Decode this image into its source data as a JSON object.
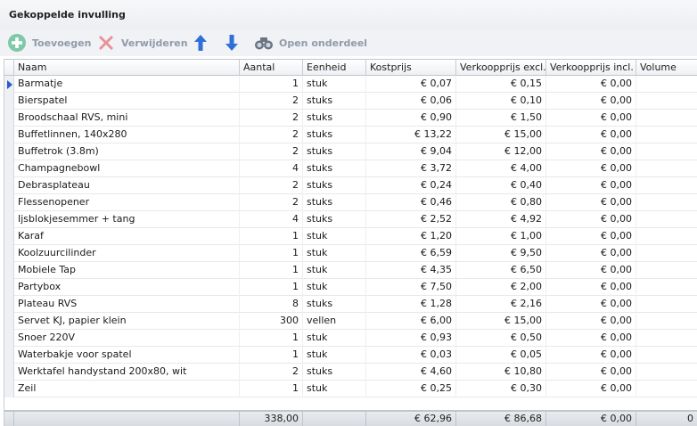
{
  "panel": {
    "title": "Gekoppelde invulling"
  },
  "toolbar": {
    "add_label": "Toevoegen",
    "delete_label": "Verwijderen",
    "open_label": "Open onderdeel"
  },
  "colors": {
    "add": "#7fc8a9",
    "delete": "#e8909a",
    "arrows": "#2f6fd6",
    "binoculars": "#6b7480"
  },
  "table": {
    "columns": {
      "name": "Naam",
      "qty": "Aantal",
      "unit": "Eenheid",
      "cost": "Kostprijs",
      "excl": "Verkoopprijs excl.",
      "incl": "Verkoopprijs incl.",
      "volume": "Volume"
    },
    "rows": [
      {
        "name": "Barmatje",
        "qty": "1",
        "unit": "stuk",
        "cost": "€ 0,07",
        "excl": "€ 0,15",
        "incl": "€ 0,00"
      },
      {
        "name": "Bierspatel",
        "qty": "2",
        "unit": "stuks",
        "cost": "€ 0,06",
        "excl": "€ 0,10",
        "incl": "€ 0,00"
      },
      {
        "name": "Broodschaal RVS, mini",
        "qty": "2",
        "unit": "stuks",
        "cost": "€ 0,90",
        "excl": "€ 1,50",
        "incl": "€ 0,00"
      },
      {
        "name": "Buffetlinnen, 140x280",
        "qty": "2",
        "unit": "stuks",
        "cost": "€ 13,22",
        "excl": "€ 15,00",
        "incl": "€ 0,00"
      },
      {
        "name": "Buffetrok (3.8m)",
        "qty": "2",
        "unit": "stuks",
        "cost": "€ 9,04",
        "excl": "€ 12,00",
        "incl": "€ 0,00"
      },
      {
        "name": "Champagnebowl",
        "qty": "4",
        "unit": "stuks",
        "cost": "€ 3,72",
        "excl": "€ 4,00",
        "incl": "€ 0,00"
      },
      {
        "name": "Debrasplateau",
        "qty": "2",
        "unit": "stuks",
        "cost": "€ 0,24",
        "excl": "€ 0,40",
        "incl": "€ 0,00"
      },
      {
        "name": "Flessenopener",
        "qty": "2",
        "unit": "stuks",
        "cost": "€ 0,46",
        "excl": "€ 0,80",
        "incl": "€ 0,00"
      },
      {
        "name": "Ijsblokjesemmer + tang",
        "qty": "4",
        "unit": "stuks",
        "cost": "€ 2,52",
        "excl": "€ 4,92",
        "incl": "€ 0,00"
      },
      {
        "name": "Karaf",
        "qty": "1",
        "unit": "stuk",
        "cost": "€ 1,20",
        "excl": "€ 1,00",
        "incl": "€ 0,00"
      },
      {
        "name": "Koolzuurcilinder",
        "qty": "1",
        "unit": "stuk",
        "cost": "€ 6,59",
        "excl": "€ 9,50",
        "incl": "€ 0,00"
      },
      {
        "name": "Mobiele Tap",
        "qty": "1",
        "unit": "stuk",
        "cost": "€ 4,35",
        "excl": "€ 6,50",
        "incl": "€ 0,00"
      },
      {
        "name": "Partybox",
        "qty": "1",
        "unit": "stuk",
        "cost": "€ 7,50",
        "excl": "€ 2,00",
        "incl": "€ 0,00"
      },
      {
        "name": "Plateau RVS",
        "qty": "8",
        "unit": "stuks",
        "cost": "€ 1,28",
        "excl": "€ 2,16",
        "incl": "€ 0,00"
      },
      {
        "name": "Servet KJ, papier klein",
        "qty": "300",
        "unit": "vellen",
        "cost": "€ 6,00",
        "excl": "€ 15,00",
        "incl": "€ 0,00"
      },
      {
        "name": "Snoer 220V",
        "qty": "1",
        "unit": "stuk",
        "cost": "€ 0,93",
        "excl": "€ 0,50",
        "incl": "€ 0,00"
      },
      {
        "name": "Waterbakje voor spatel",
        "qty": "1",
        "unit": "stuk",
        "cost": "€ 0,03",
        "excl": "€ 0,05",
        "incl": "€ 0,00"
      },
      {
        "name": "Werktafel handystand 200x80, wit",
        "qty": "2",
        "unit": "stuks",
        "cost": "€ 4,60",
        "excl": "€ 10,80",
        "incl": "€ 0,00"
      },
      {
        "name": "Zeil",
        "qty": "1",
        "unit": "stuk",
        "cost": "€ 0,25",
        "excl": "€ 0,30",
        "incl": "€ 0,00"
      }
    ],
    "totals": {
      "qty": "338,00",
      "cost": "€ 62,96",
      "excl": "€ 86,68",
      "incl": "€ 0,00",
      "volume": "0"
    }
  }
}
